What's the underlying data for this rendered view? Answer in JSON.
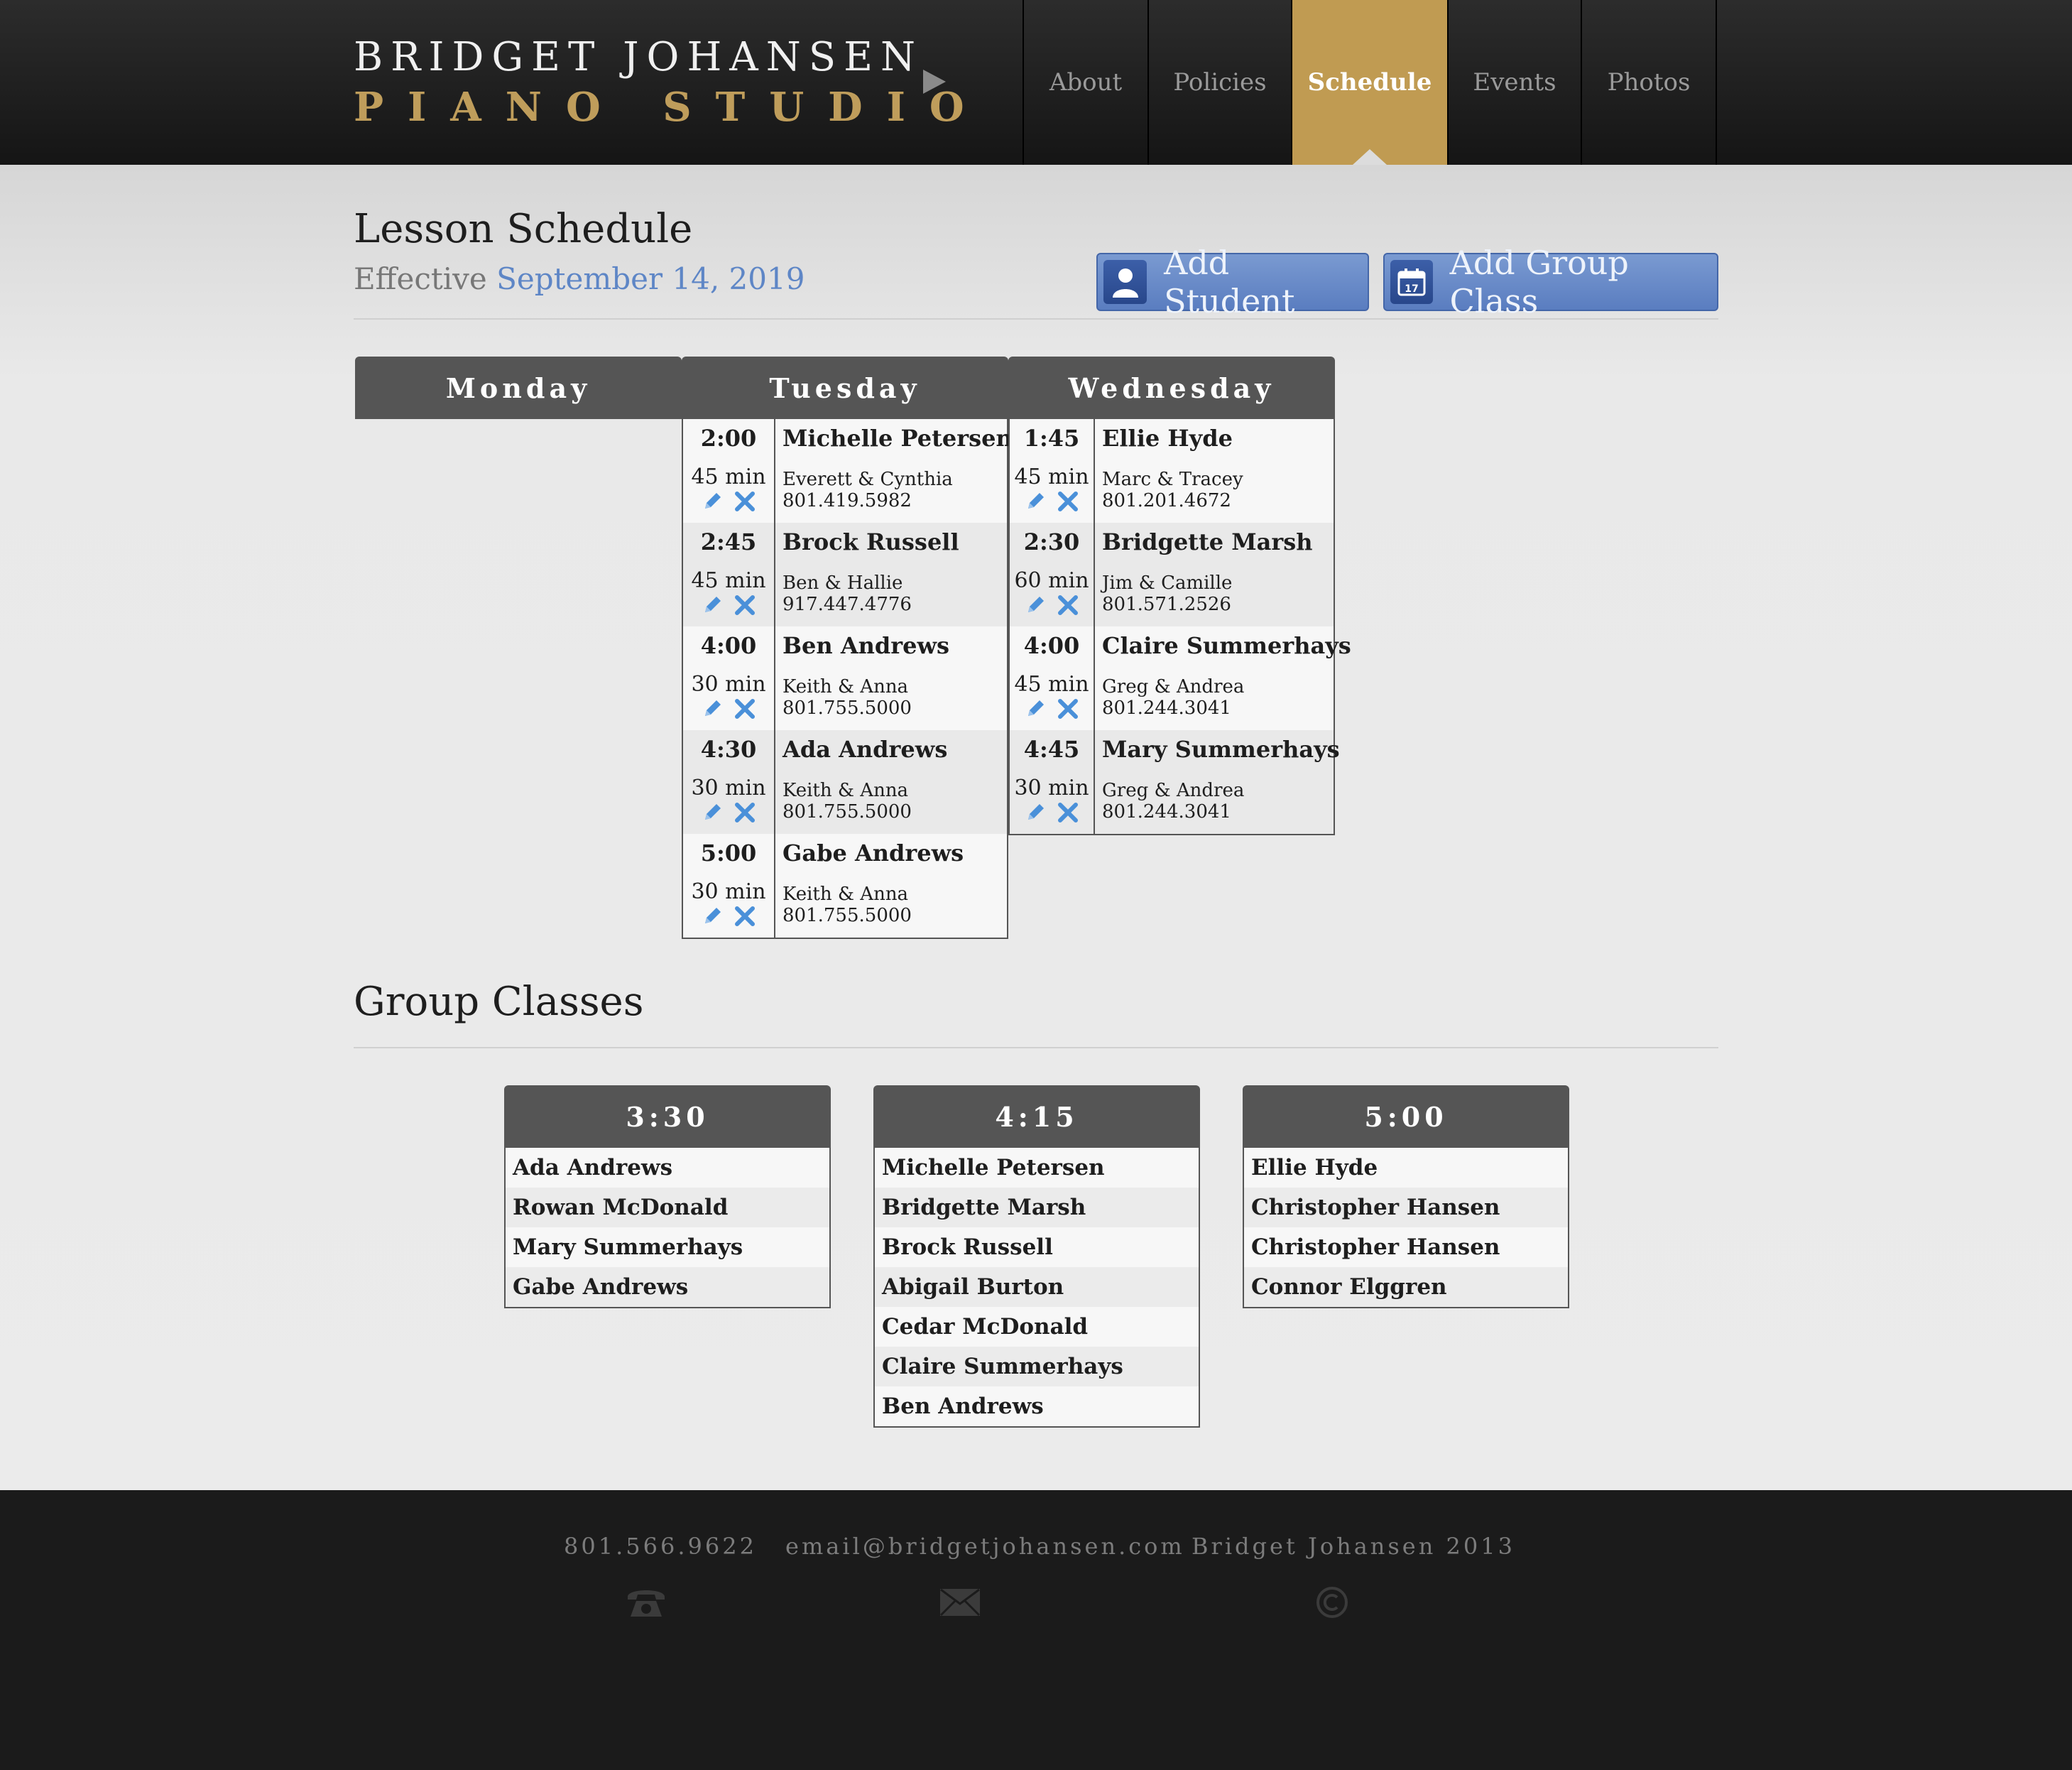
{
  "header": {
    "logo_line1": "BRIDGET JOHANSEN",
    "logo_line2": "PIANO STUDIO",
    "nav": [
      {
        "label": "About",
        "active": false
      },
      {
        "label": "Policies",
        "active": false
      },
      {
        "label": "Schedule",
        "active": true
      },
      {
        "label": "Events",
        "active": false
      },
      {
        "label": "Photos",
        "active": false
      }
    ]
  },
  "lessons": {
    "title": "Lesson Schedule",
    "effective_label": "Effective",
    "effective_date": "September 14, 2019",
    "add_student_label": "Add Student",
    "add_group_label": "Add Group Class",
    "days": [
      {
        "name": "Monday",
        "slots": []
      },
      {
        "name": "Tuesday",
        "slots": [
          {
            "time": "2:00",
            "duration": "45 min",
            "student": "Michelle Petersen",
            "parents": "Everett & Cynthia",
            "phone": "801.419.5982"
          },
          {
            "time": "2:45",
            "duration": "45 min",
            "student": "Brock Russell",
            "parents": "Ben & Hallie",
            "phone": "917.447.4776"
          },
          {
            "time": "4:00",
            "duration": "30 min",
            "student": "Ben Andrews",
            "parents": "Keith & Anna",
            "phone": "801.755.5000"
          },
          {
            "time": "4:30",
            "duration": "30 min",
            "student": "Ada Andrews",
            "parents": "Keith & Anna",
            "phone": "801.755.5000"
          },
          {
            "time": "5:00",
            "duration": "30 min",
            "student": "Gabe Andrews",
            "parents": "Keith & Anna",
            "phone": "801.755.5000"
          }
        ]
      },
      {
        "name": "Wednesday",
        "slots": [
          {
            "time": "1:45",
            "duration": "45 min",
            "student": "Ellie Hyde",
            "parents": "Marc & Tracey",
            "phone": "801.201.4672"
          },
          {
            "time": "2:30",
            "duration": "60 min",
            "student": "Bridgette Marsh",
            "parents": "Jim & Camille",
            "phone": "801.571.2526"
          },
          {
            "time": "4:00",
            "duration": "45 min",
            "student": "Claire Summerhays",
            "parents": "Greg & Andrea",
            "phone": "801.244.3041"
          },
          {
            "time": "4:45",
            "duration": "30 min",
            "student": "Mary Summerhays",
            "parents": "Greg & Andrea",
            "phone": "801.244.3041"
          }
        ]
      }
    ]
  },
  "group_classes": {
    "title": "Group Classes",
    "classes": [
      {
        "time": "3:30",
        "students": [
          "Ada Andrews",
          "Rowan McDonald",
          "Mary Summerhays",
          "Gabe Andrews"
        ]
      },
      {
        "time": "4:15",
        "students": [
          "Michelle Petersen",
          "Bridgette Marsh",
          "Brock Russell",
          "Abigail Burton",
          "Cedar McDonald",
          "Claire Summerhays",
          "Ben Andrews"
        ]
      },
      {
        "time": "5:00",
        "students": [
          "Ellie Hyde",
          "Christopher Hansen",
          "Christopher Hansen",
          "Connor Elggren"
        ]
      }
    ]
  },
  "footer": {
    "phone": "801.566.9622",
    "email": "email@bridgetjohansen.com",
    "copyright": "Bridget Johansen 2013",
    "icons": [
      "phone-icon",
      "envelope-icon",
      "copyright-icon"
    ]
  },
  "colors": {
    "accent_gold": "#c09b52",
    "button_blue": "#6b8dcb",
    "link_blue": "#5e86c6",
    "edit_icon_blue": "#4a90d9"
  }
}
